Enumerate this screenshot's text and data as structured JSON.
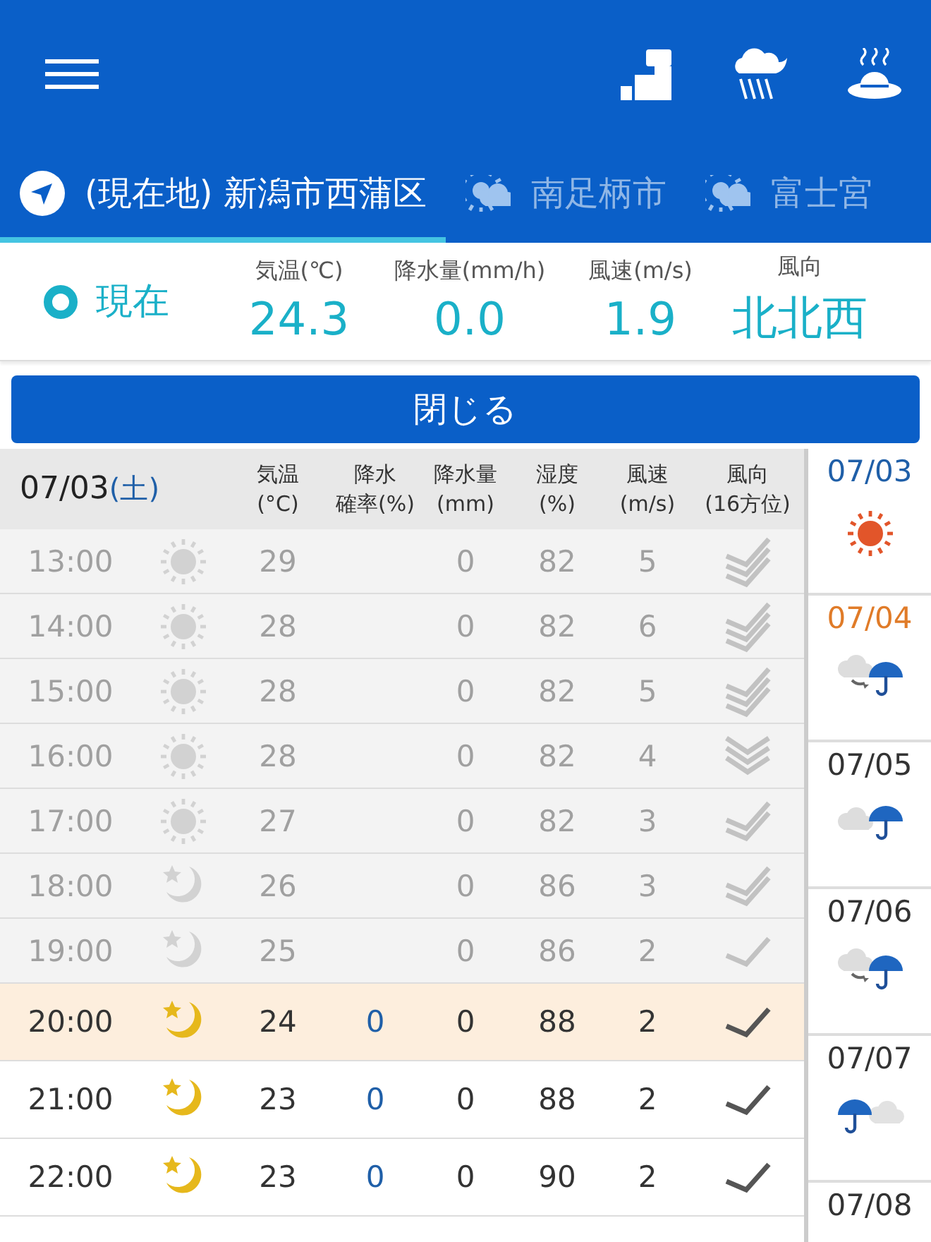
{
  "tabs": [
    {
      "label": "(現在地) 新潟市西蒲区",
      "kind": "location",
      "selected": true
    },
    {
      "label": "南足柄市",
      "kind": "city",
      "selected": false
    },
    {
      "label": "富士宮",
      "kind": "city",
      "selected": false
    }
  ],
  "current": {
    "label": "現在",
    "readings": [
      {
        "label": "気温(℃)",
        "value": "24.3"
      },
      {
        "label": "降水量(mm/h)",
        "value": "0.0"
      },
      {
        "label": "風速(m/s)",
        "value": "1.9"
      },
      {
        "label": "風向",
        "value": "北北西"
      }
    ]
  },
  "close_button": "閉じる",
  "table": {
    "date": "07/03",
    "weekday": {
      "text": "(土)",
      "color": "#1f5fa8"
    },
    "columns": [
      [
        "気温",
        "(°C)"
      ],
      [
        "降水",
        "確率(%)"
      ],
      [
        "降水量",
        "(mm)"
      ],
      [
        "湿度",
        "(%)"
      ],
      [
        "風速",
        "(m/s)"
      ],
      [
        "風向",
        "(16方位)"
      ]
    ],
    "rows": [
      {
        "time": "13:00",
        "kind": "sun",
        "temp": "29",
        "precip": "0",
        "humidity": "82",
        "wind": "5",
        "direction_icon": {
          "kind": "check3"
        },
        "past": true,
        "current": false
      },
      {
        "time": "14:00",
        "kind": "sun",
        "temp": "28",
        "precip": "0",
        "humidity": "82",
        "wind": "6",
        "direction_icon": {
          "kind": "check3"
        },
        "past": true,
        "current": false
      },
      {
        "time": "15:00",
        "kind": "sun",
        "temp": "28",
        "precip": "0",
        "humidity": "82",
        "wind": "5",
        "direction_icon": {
          "kind": "check3"
        },
        "past": true,
        "current": false
      },
      {
        "time": "16:00",
        "kind": "sun",
        "temp": "28",
        "precip": "0",
        "humidity": "82",
        "wind": "4",
        "direction_icon": {
          "kind": "vee3"
        },
        "past": true,
        "current": false
      },
      {
        "time": "17:00",
        "kind": "sun",
        "temp": "27",
        "precip": "0",
        "humidity": "82",
        "wind": "3",
        "direction_icon": {
          "kind": "check2"
        },
        "past": true,
        "current": false
      },
      {
        "time": "18:00",
        "kind": "moon",
        "temp": "26",
        "precip": "0",
        "humidity": "86",
        "wind": "3",
        "direction_icon": {
          "kind": "check2"
        },
        "past": true,
        "current": false
      },
      {
        "time": "19:00",
        "kind": "moon",
        "temp": "25",
        "precip": "0",
        "humidity": "86",
        "wind": "2",
        "direction_icon": {
          "kind": "check1"
        },
        "past": true,
        "current": false
      },
      {
        "time": "20:00",
        "kind": "moon",
        "temp": "24",
        "prob": "0",
        "precip": "0",
        "humidity": "88",
        "wind": "2",
        "direction_icon": {
          "kind": "check1"
        },
        "past": false,
        "current": true
      },
      {
        "time": "21:00",
        "kind": "moon",
        "temp": "23",
        "prob": "0",
        "precip": "0",
        "humidity": "88",
        "wind": "2",
        "direction_icon": {
          "kind": "check1"
        },
        "past": false,
        "current": false
      },
      {
        "time": "22:00",
        "kind": "moon",
        "temp": "23",
        "prob": "0",
        "precip": "0",
        "humidity": "90",
        "wind": "2",
        "direction_icon": {
          "kind": "check1"
        },
        "past": false,
        "current": false
      }
    ]
  },
  "days": [
    {
      "date": "07/03",
      "color": "#1f5fa8",
      "kind": "sun"
    },
    {
      "date": "07/04",
      "color": "#e07b28",
      "kind": "cloud-then-rain"
    },
    {
      "date": "07/05",
      "color": "#333333",
      "kind": "cloud-rain"
    },
    {
      "date": "07/06",
      "color": "#333333",
      "kind": "cloud-then-rain"
    },
    {
      "date": "07/07",
      "color": "#333333",
      "kind": "rain-cloud"
    },
    {
      "date": "07/08",
      "color": "#333333"
    }
  ]
}
